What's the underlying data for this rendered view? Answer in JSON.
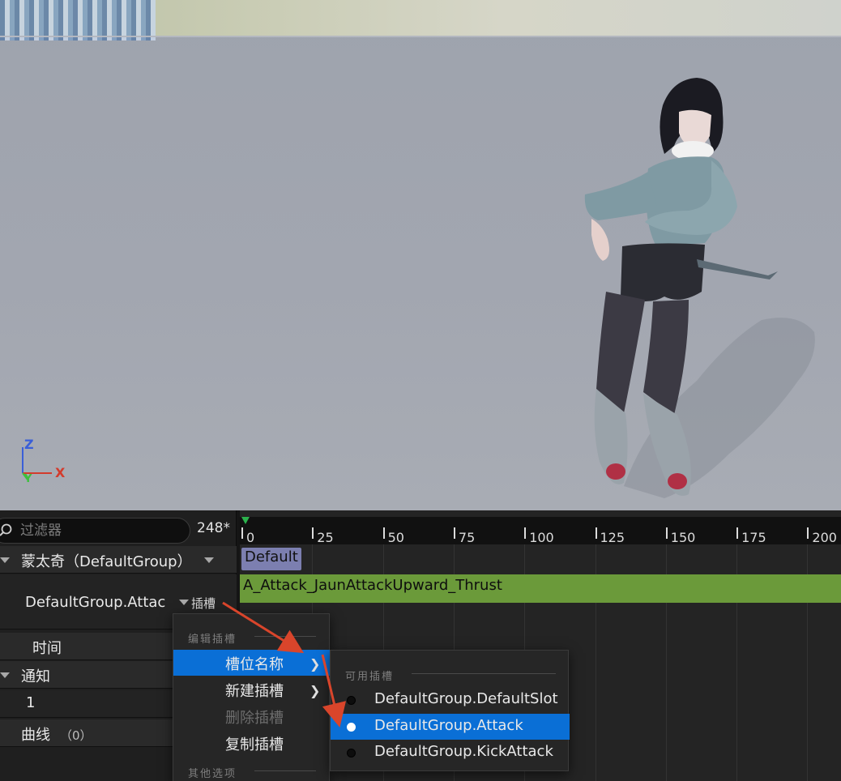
{
  "viewport": {
    "axis": {
      "z": "Z",
      "y": "Y",
      "x": "X"
    }
  },
  "filter": {
    "placeholder": "过滤器"
  },
  "frame_count": "248*",
  "tracks": {
    "montage": "蒙太奇（DefaultGroup）",
    "slot": "DefaultGroup.Attac",
    "slot_button": "插槽",
    "time": "时间",
    "notify": "通知",
    "notify_track": "1",
    "curves": "曲线",
    "curves_count": "（0）"
  },
  "timeline": {
    "ticks": [
      "0",
      "25",
      "50",
      "75",
      "100",
      "125",
      "150",
      "175",
      "200"
    ],
    "section": "Default",
    "segment": "A_Attack_JaunAttackUpward_Thrust"
  },
  "slot_menu": {
    "section_edit": "编辑插槽",
    "items": [
      {
        "label": "槽位名称",
        "has_submenu": true,
        "highlighted": true,
        "enabled": true
      },
      {
        "label": "新建插槽",
        "has_submenu": true,
        "highlighted": false,
        "enabled": true
      },
      {
        "label": "删除插槽",
        "has_submenu": false,
        "highlighted": false,
        "enabled": false
      },
      {
        "label": "复制插槽",
        "has_submenu": false,
        "highlighted": false,
        "enabled": true
      }
    ],
    "section_other": "其他选项"
  },
  "submenu": {
    "section": "可用插槽",
    "items": [
      {
        "label": "DefaultGroup.DefaultSlot",
        "selected": false
      },
      {
        "label": "DefaultGroup.Attack",
        "selected": true
      },
      {
        "label": "DefaultGroup.KickAttack",
        "selected": false
      }
    ]
  },
  "colors": {
    "accent": "#0a6fd6",
    "segment": "#6b9a3a",
    "section_tag": "#7c7fb0",
    "annotation_arrow": "#d9452b"
  }
}
